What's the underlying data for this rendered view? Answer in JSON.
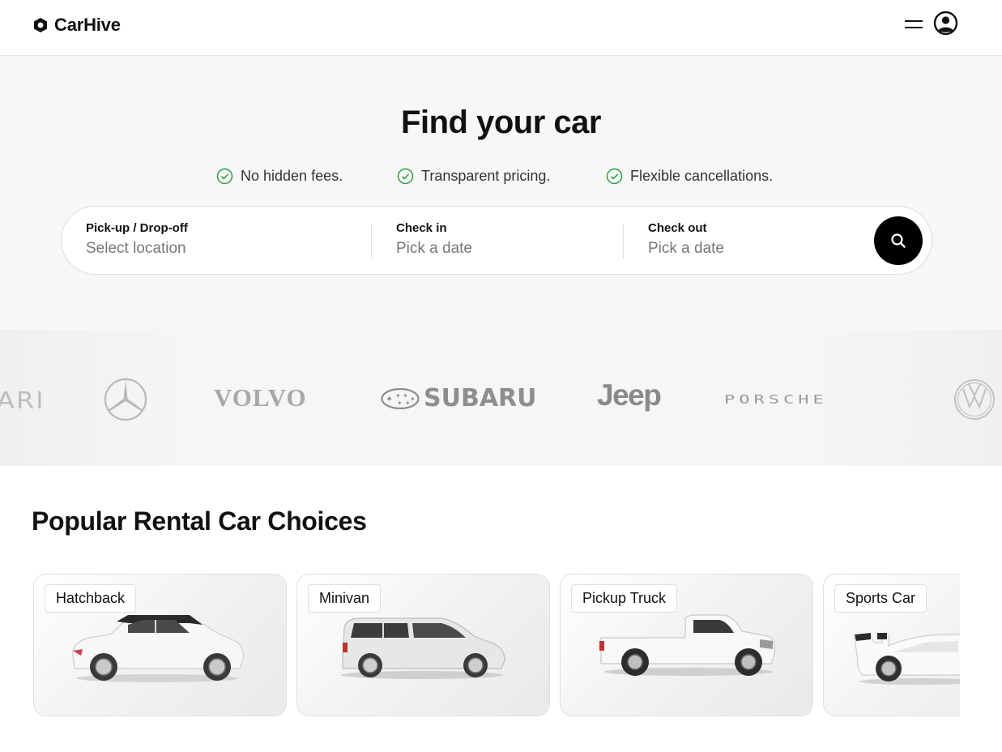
{
  "header": {
    "logo_text": "CarHive",
    "menu_icon": "hamburger-menu-icon",
    "account_icon": "user-circle-icon"
  },
  "hero": {
    "title": "Find your car",
    "features": [
      "No hidden fees.",
      "Transparent pricing.",
      "Flexible cancellations."
    ],
    "check_color": "#2e9e47",
    "search": {
      "location_label": "Pick-up / Drop-off",
      "location_placeholder": "Select location",
      "checkin_label": "Check in",
      "checkin_placeholder": "Pick a date",
      "checkout_label": "Check out",
      "checkout_placeholder": "Pick a date",
      "button_icon": "search-icon"
    },
    "brands": [
      "Ferrari",
      "Mercedes-Benz",
      "VOLVO",
      "SUBARU",
      "Jeep",
      "PORSCHE",
      "Volkswagen"
    ],
    "brand_texts": {
      "ferrari_partial": "ARI",
      "volvo": "VOLVO",
      "subaru": "SUBARU",
      "jeep": "Jeep",
      "porsche": "PORSCHE"
    }
  },
  "popular": {
    "title": "Popular Rental Car Choices",
    "cards": [
      {
        "label": "Hatchback"
      },
      {
        "label": "Minivan"
      },
      {
        "label": "Pickup Truck"
      },
      {
        "label": "Sports Car"
      }
    ]
  }
}
